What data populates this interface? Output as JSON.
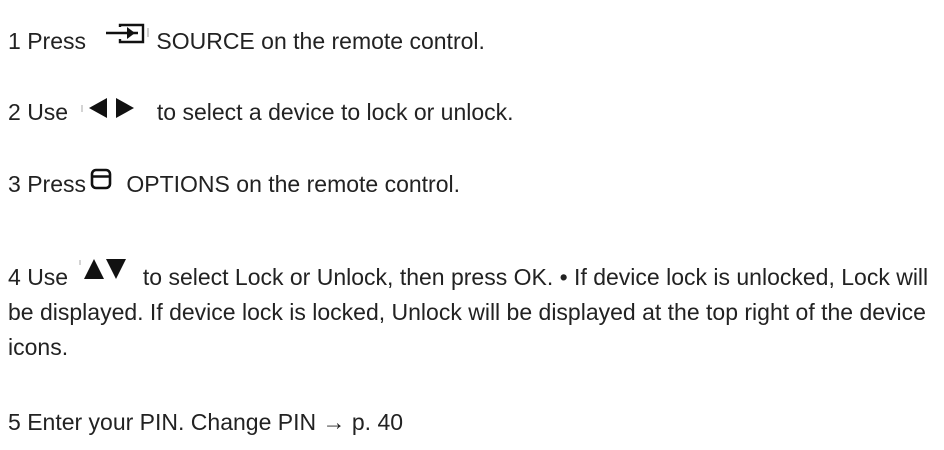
{
  "steps": [
    {
      "number": "1",
      "before": "Press",
      "icon": "source-icon",
      "after": "SOURCE on the remote control."
    },
    {
      "number": "2",
      "before": "Use",
      "icon": "left-right-arrows-icon",
      "after": "to select a device to lock or unlock."
    },
    {
      "number": "3",
      "before": "Press",
      "icon": "options-icon",
      "after": "OPTIONS on the remote control."
    },
    {
      "number": "4",
      "before": "Use",
      "icon": "up-down-arrows-icon",
      "after": "to select Lock or Unlock, then press OK. • If device lock is unlocked, Lock will be displayed. If device lock is locked, Unlock will be displayed at the top right of the device icons."
    },
    {
      "number": "5",
      "text": "Enter your PIN. Change PIN → p. 40"
    }
  ]
}
